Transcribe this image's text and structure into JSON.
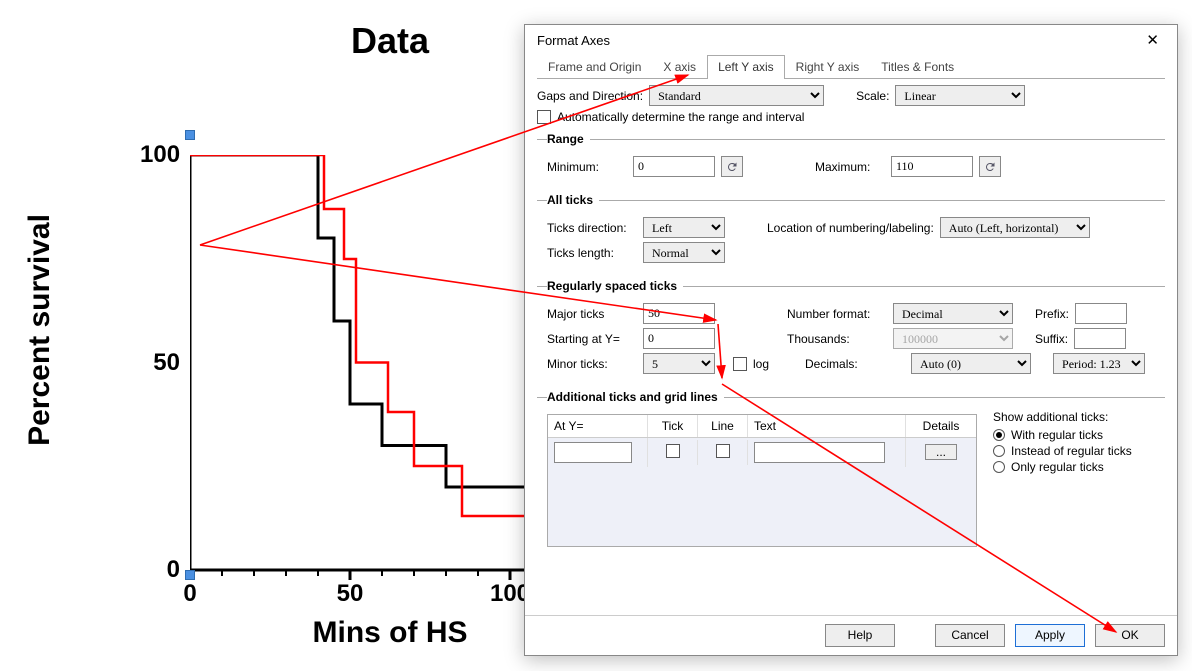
{
  "chart_data": {
    "type": "line",
    "title": "Data",
    "xlabel": "Mins of HS",
    "ylabel": "Percent survival",
    "xlim": [
      0,
      100
    ],
    "ylim": [
      0,
      100
    ],
    "xticks": [
      0,
      50,
      100
    ],
    "yticks": [
      0,
      50,
      100
    ],
    "series": [
      {
        "name": "black",
        "color": "#000000",
        "x": [
          0,
          40,
          40,
          45,
          45,
          50,
          50,
          60,
          60,
          80,
          80,
          100
        ],
        "y": [
          100,
          100,
          80,
          80,
          60,
          60,
          40,
          40,
          30,
          30,
          20,
          20
        ]
      },
      {
        "name": "red",
        "color": "#ff0000",
        "x": [
          0,
          42,
          42,
          48,
          48,
          52,
          52,
          62,
          62,
          70,
          70,
          85,
          85,
          100
        ],
        "y": [
          100,
          100,
          87,
          87,
          75,
          75,
          50,
          50,
          38,
          38,
          25,
          25,
          13,
          13
        ]
      }
    ]
  },
  "dialog": {
    "title": "Format Axes",
    "tabs": {
      "frame": "Frame and Origin",
      "xaxis": "X axis",
      "lefty": "Left Y axis",
      "righty": "Right Y axis",
      "titles": "Titles & Fonts"
    },
    "gaps_label": "Gaps and Direction:",
    "gaps_value": "Standard",
    "scale_label": "Scale:",
    "scale_value": "Linear",
    "auto_label": "Automatically determine the range and interval",
    "range_legend": "Range",
    "min_label": "Minimum:",
    "min_value": "0",
    "max_label": "Maximum:",
    "max_value": "110",
    "allticks_legend": "All ticks",
    "ticks_dir_label": "Ticks direction:",
    "ticks_dir_value": "Left",
    "ticks_len_label": "Ticks length:",
    "ticks_len_value": "Normal",
    "loc_label": "Location of numbering/labeling:",
    "loc_value": "Auto (Left, horizontal)",
    "regticks_legend": "Regularly spaced ticks",
    "major_label": "Major ticks",
    "major_value": "50",
    "starting_label": "Starting at Y=",
    "starting_value": "0",
    "minor_label": "Minor ticks:",
    "minor_value": "5",
    "log_label": "log",
    "numfmt_label": "Number format:",
    "numfmt_value": "Decimal",
    "thousands_label": "Thousands:",
    "thousands_value": "100000",
    "decimals_label": "Decimals:",
    "decimals_value": "Auto (0)",
    "prefix_label": "Prefix:",
    "suffix_label": "Suffix:",
    "period_label": "Period: 1.23",
    "addticks_legend": "Additional ticks and grid lines",
    "col_aty": "At Y=",
    "col_tick": "Tick",
    "col_line": "Line",
    "col_text": "Text",
    "col_details": "Details",
    "details_btn": "...",
    "show_add_label": "Show additional ticks:",
    "radio_with": "With regular ticks",
    "radio_instead": "Instead of regular ticks",
    "radio_only": "Only regular ticks",
    "help": "Help",
    "cancel": "Cancel",
    "apply": "Apply",
    "ok": "OK"
  }
}
